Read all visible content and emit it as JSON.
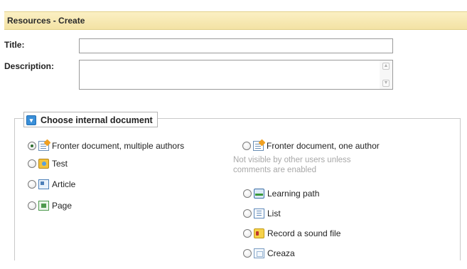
{
  "header": {
    "title": "Resources - Create"
  },
  "form": {
    "title_label": "Title:",
    "title_value": "",
    "description_label": "Description:",
    "description_value": ""
  },
  "section": {
    "legend": "Choose internal document",
    "options_left": [
      {
        "label": "Fronter document, multiple authors",
        "icon": "fronter-document-icon",
        "checked": true
      },
      {
        "label": "Test",
        "icon": "test-icon",
        "checked": false
      },
      {
        "label": "Article",
        "icon": "article-icon",
        "checked": false
      },
      {
        "label": "Page",
        "icon": "page-icon",
        "checked": false
      }
    ],
    "option_right_top": {
      "label": "Fronter document, one author",
      "icon": "fronter-document-icon",
      "checked": false
    },
    "note_line1": "Not visible by other users unless",
    "note_line2": "comments are enabled",
    "options_right": [
      {
        "label": "Learning path",
        "icon": "learning-path-icon",
        "checked": false
      },
      {
        "label": "List",
        "icon": "list-icon",
        "checked": false
      },
      {
        "label": "Record a sound file",
        "icon": "sound-file-icon",
        "checked": false
      },
      {
        "label": "Creaza",
        "icon": "creaza-icon",
        "checked": false
      }
    ]
  },
  "colors": {
    "header_bg": "#f6e8b1",
    "selected_radio": "#2f6f2f",
    "legend_icon": "#3a8fd8"
  }
}
